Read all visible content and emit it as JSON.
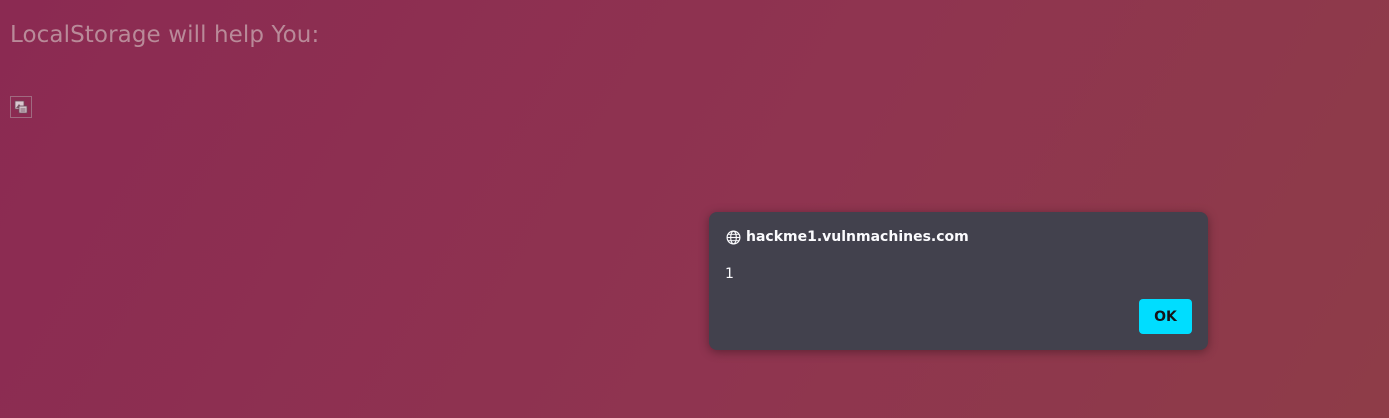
{
  "page": {
    "heading": "LocalStorage will help You:",
    "image_icon": "broken-image-icon"
  },
  "alert": {
    "origin": "hackme1.vulnmachines.com",
    "origin_icon": "globe-icon",
    "message": "1",
    "ok_label": "OK"
  },
  "colors": {
    "background_start": "#8b2a52",
    "background_end": "#8e3c48",
    "dialog_bg": "#42414d",
    "ok_button": "#00ddff"
  }
}
